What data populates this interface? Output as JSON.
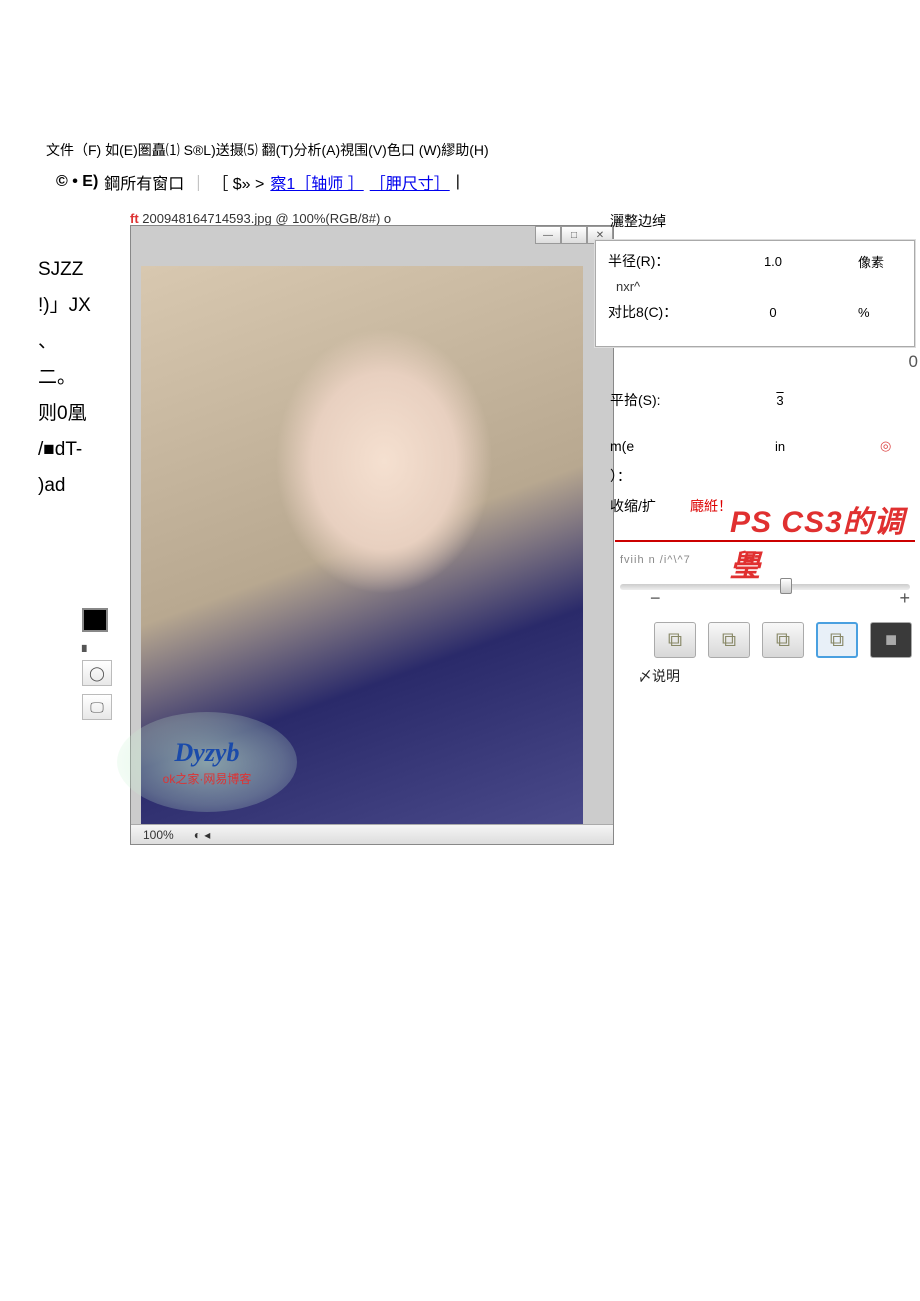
{
  "menu_bar": "文件（F) 如(E)圏矗⑴ S®L)送摄⑸ 翻(T)分析(A)視围(V)色口 (W)繆助(H)",
  "option_bar": {
    "copyright": "© • E)",
    "text1": "鋼所有窗口",
    "brackets": "［ $» >",
    "link1": "察1［轴师 ］",
    "link2": "［胛尺寸］"
  },
  "document": {
    "prefix": "ft",
    "title": " 200948164714593.jpg @ 100%(RGB/8#) o",
    "zoom": "100%"
  },
  "left_fragments": [
    "SJZZ",
    "",
    "!)」JX",
    "、",
    "二。",
    "则0凰",
    "/■dT-",
    ")ad"
  ],
  "watermark": {
    "logo": "Dyzyb",
    "sub": "ok之家·网易博客"
  },
  "panel_title": "灑整边绰",
  "dialog": {
    "radius": {
      "label": "半径(R)：",
      "value": "1.0",
      "unit": "像素"
    },
    "nxr": "nxr^",
    "contrast": {
      "label": "对比8(C)：",
      "value": "0",
      "unit": "%"
    }
  },
  "sub": {
    "big_zero": "0",
    "smooth": {
      "label": "平拾(S):",
      "value": "3",
      "unit": ""
    },
    "me": {
      "label": "m(e",
      "value": "in",
      "icon": "◎"
    },
    "paren": "）：",
    "shrink": {
      "label": "收缩/扩",
      "red": "廰絍！"
    }
  },
  "ps_title": "PS CS3的调璺",
  "slider": {
    "blurred": "fviih n /i^\\^7"
  },
  "zoom_bar": {
    "minus": "−",
    "plus": "+"
  },
  "desc": "〆说明"
}
